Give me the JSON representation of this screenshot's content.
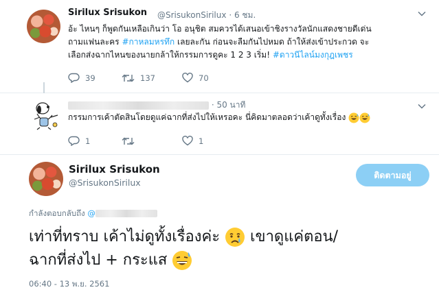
{
  "tweets": [
    {
      "name": "Sirilux Srisukon",
      "handle": "@SrisukonSirilux",
      "time": "· 6 ชม.",
      "text_parts": [
        "อ้ะ ไหนๆ ก็พูดกันเหลือเกินว่า โอ อนุชิต สมควรได้เสนอเข้าชิงรางวัลนักแสดงชายดีเด่น",
        "ถามแฟนละคร ",
        "#กาหลมหรทึก",
        " เลยละกัน ก่อนจะลืมกันไปหมด ถ้าให้ส่งเข้าประกวด จะ",
        "เลือกส่งฉากไหนของนายกล้าให้กรรมการดูคะ 1 2 3 เริ่ม! ",
        "#ดาวนีไลน์มงกุฎเพชร"
      ],
      "replies": "39",
      "retweets": "137",
      "likes": "70"
    },
    {
      "time": "· 50 นาที",
      "text": "กรรมการเค้าตัดสินโดยดูแค่ฉากที่ส่งไปให้เหรอคะ นี่คิดมาตลอดว่าเค้าดูทั้งเรื่อง",
      "replies": "1",
      "retweets": "",
      "likes": "1"
    }
  ],
  "focus": {
    "name": "Sirilux Srisukon",
    "handle": "@SrisukonSirilux",
    "follow_label": "ติดตามอยู่",
    "replying_label": "กำลังตอบกลับถึง ",
    "replying_at": "@",
    "text_line1": "เท่าที่ทราบ เค้าไม่ดูทั้งเรื่องค่ะ ",
    "text_line1b": " เขาดูแค่ตอน/",
    "text_line2": "ฉากที่ส่งไป + กระแส ",
    "timestamp": "06:40 - 13 พ.ย. 2561"
  },
  "colors": {
    "accent": "#1da1f2",
    "muted": "#657786",
    "follow_bg": "#8ccff5"
  },
  "icons": [
    "reply-icon",
    "retweet-icon",
    "like-icon",
    "chevron-down-icon",
    "crying-face-icon",
    "grinning-sweat-icon"
  ]
}
